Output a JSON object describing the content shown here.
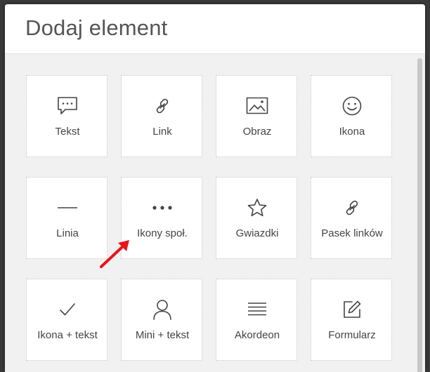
{
  "dialog": {
    "title": "Dodaj element"
  },
  "elements": [
    {
      "label": "Tekst",
      "icon": "chat-bubble-icon"
    },
    {
      "label": "Link",
      "icon": "link-icon"
    },
    {
      "label": "Obraz",
      "icon": "image-icon"
    },
    {
      "label": "Ikona",
      "icon": "smiley-icon"
    },
    {
      "label": "Linia",
      "icon": "horizontal-line-icon"
    },
    {
      "label": "Ikony społ.",
      "icon": "dots-icon"
    },
    {
      "label": "Gwiazdki",
      "icon": "star-icon"
    },
    {
      "label": "Pasek linków",
      "icon": "link-icon"
    },
    {
      "label": "Ikona + tekst",
      "icon": "checkmark-icon"
    },
    {
      "label": "Mini + tekst",
      "icon": "user-icon"
    },
    {
      "label": "Akordeon",
      "icon": "list-lines-icon"
    },
    {
      "label": "Formularz",
      "icon": "edit-form-icon"
    }
  ],
  "colors": {
    "icon": "#444444",
    "annotation_arrow": "#e8141b"
  }
}
